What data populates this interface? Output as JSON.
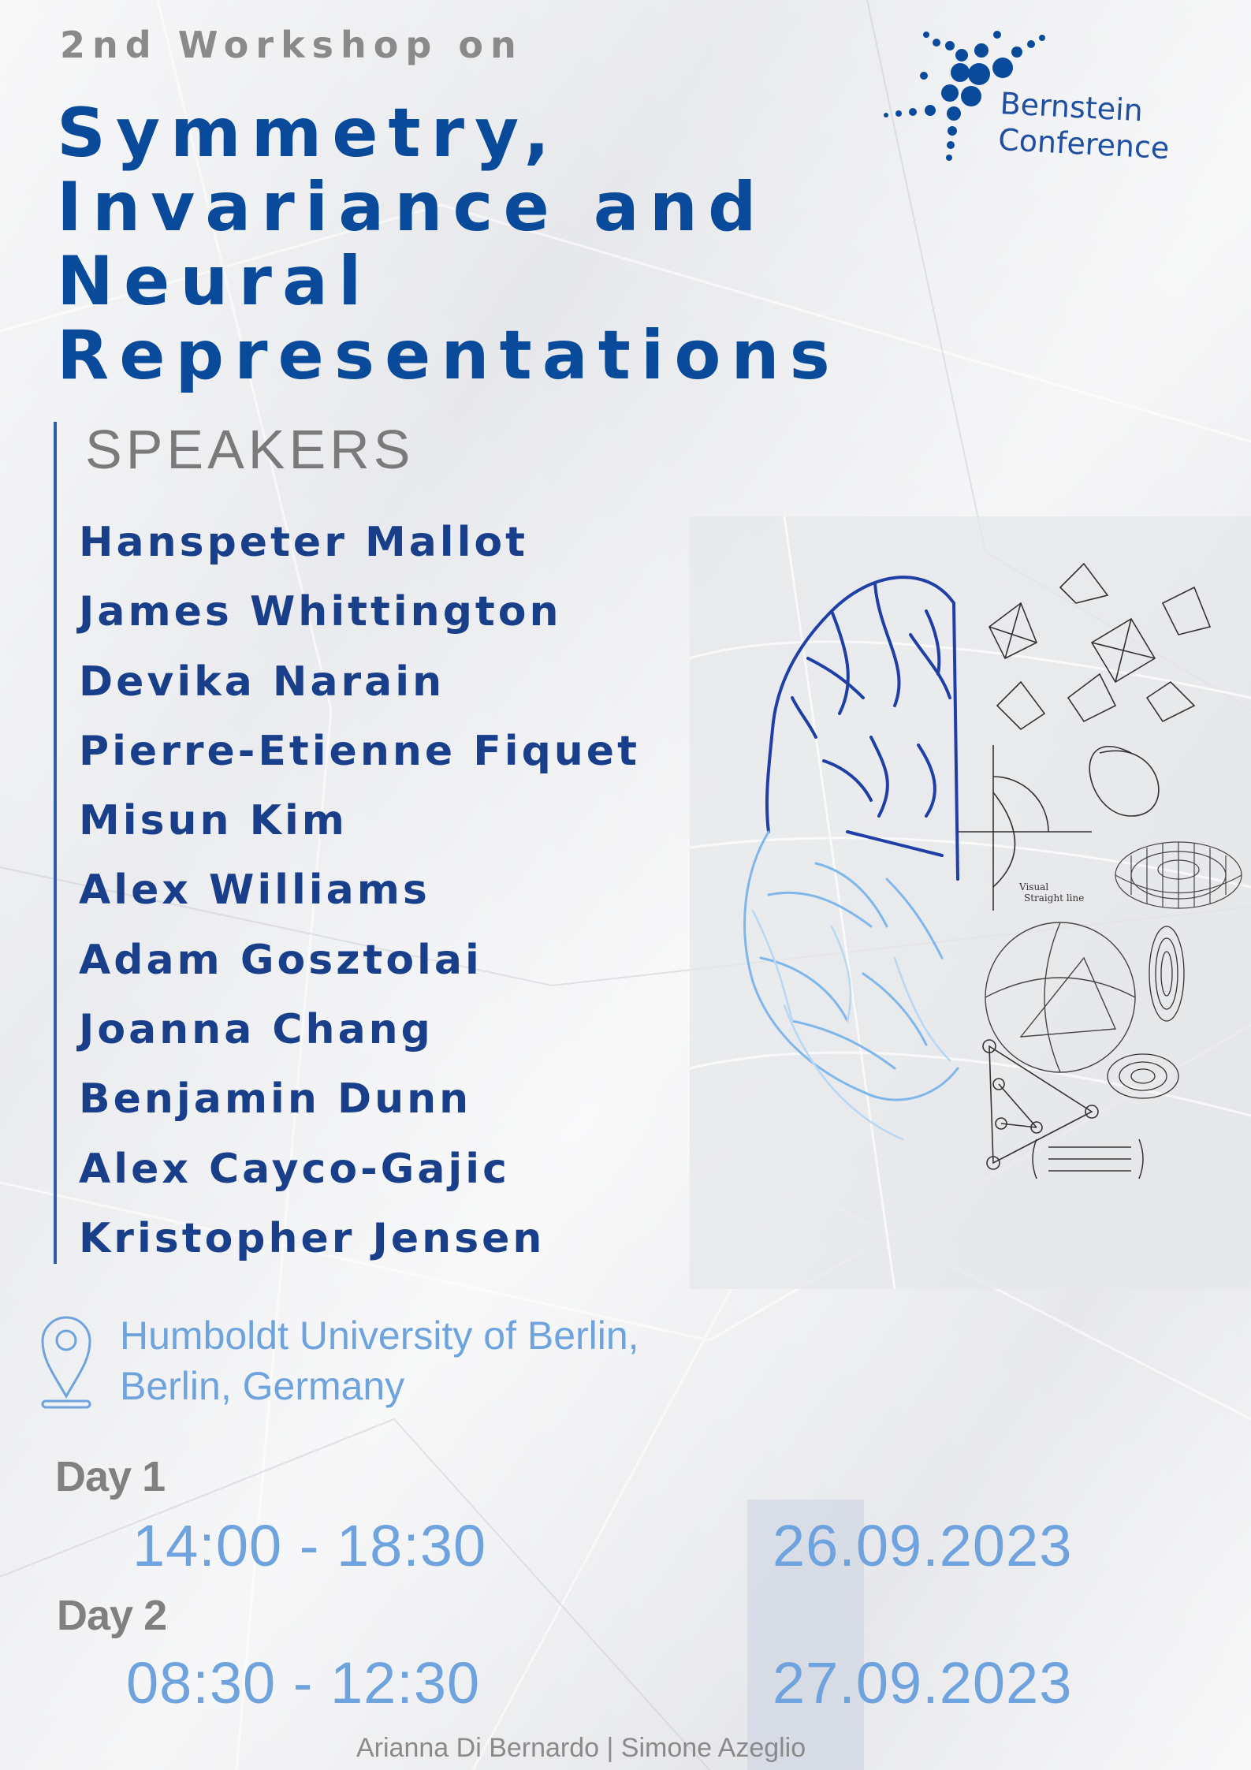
{
  "header": {
    "eyebrow": "2nd Workshop on",
    "title_lines": [
      "Symmetry,",
      "Invariance and",
      "Neural",
      "Representations"
    ]
  },
  "logo": {
    "line1": "Bernstein",
    "line2": "Conference",
    "icon": "bernstein-dots-logo",
    "color": "#0a4a9b"
  },
  "speakers": {
    "heading": "SPEAKERS",
    "names": [
      "Hanspeter Mallot",
      "James Whittington",
      "Devika Narain",
      "Pierre-Etienne Fiquet",
      "Misun Kim",
      "Alex Williams",
      "Adam Gosztolai",
      "Joanna Chang",
      "Benjamin Dunn",
      "Alex Cayco-Gajic",
      "Kristopher Jensen"
    ]
  },
  "illustration": {
    "icon": "brain-and-geometry-illustration",
    "labels": {
      "visual_straight_line": [
        "Visual",
        "Straight line"
      ]
    }
  },
  "location": {
    "icon": "map-pin-icon",
    "line1": "Humboldt University of Berlin,",
    "line2": "Berlin, Germany"
  },
  "schedule": {
    "day1": {
      "label": "Day 1",
      "time": "14:00 - 18:30",
      "date": "26.09.2023"
    },
    "day2": {
      "label": "Day 2",
      "time": "08:30 - 12:30",
      "date": "27.09.2023"
    }
  },
  "credits": "Arianna Di Bernardo | Simone Azeglio",
  "colors": {
    "title_blue": "#0a4a9b",
    "speaker_blue": "#1a3f8a",
    "light_blue": "#6ea3dd",
    "gray": "#808080"
  }
}
